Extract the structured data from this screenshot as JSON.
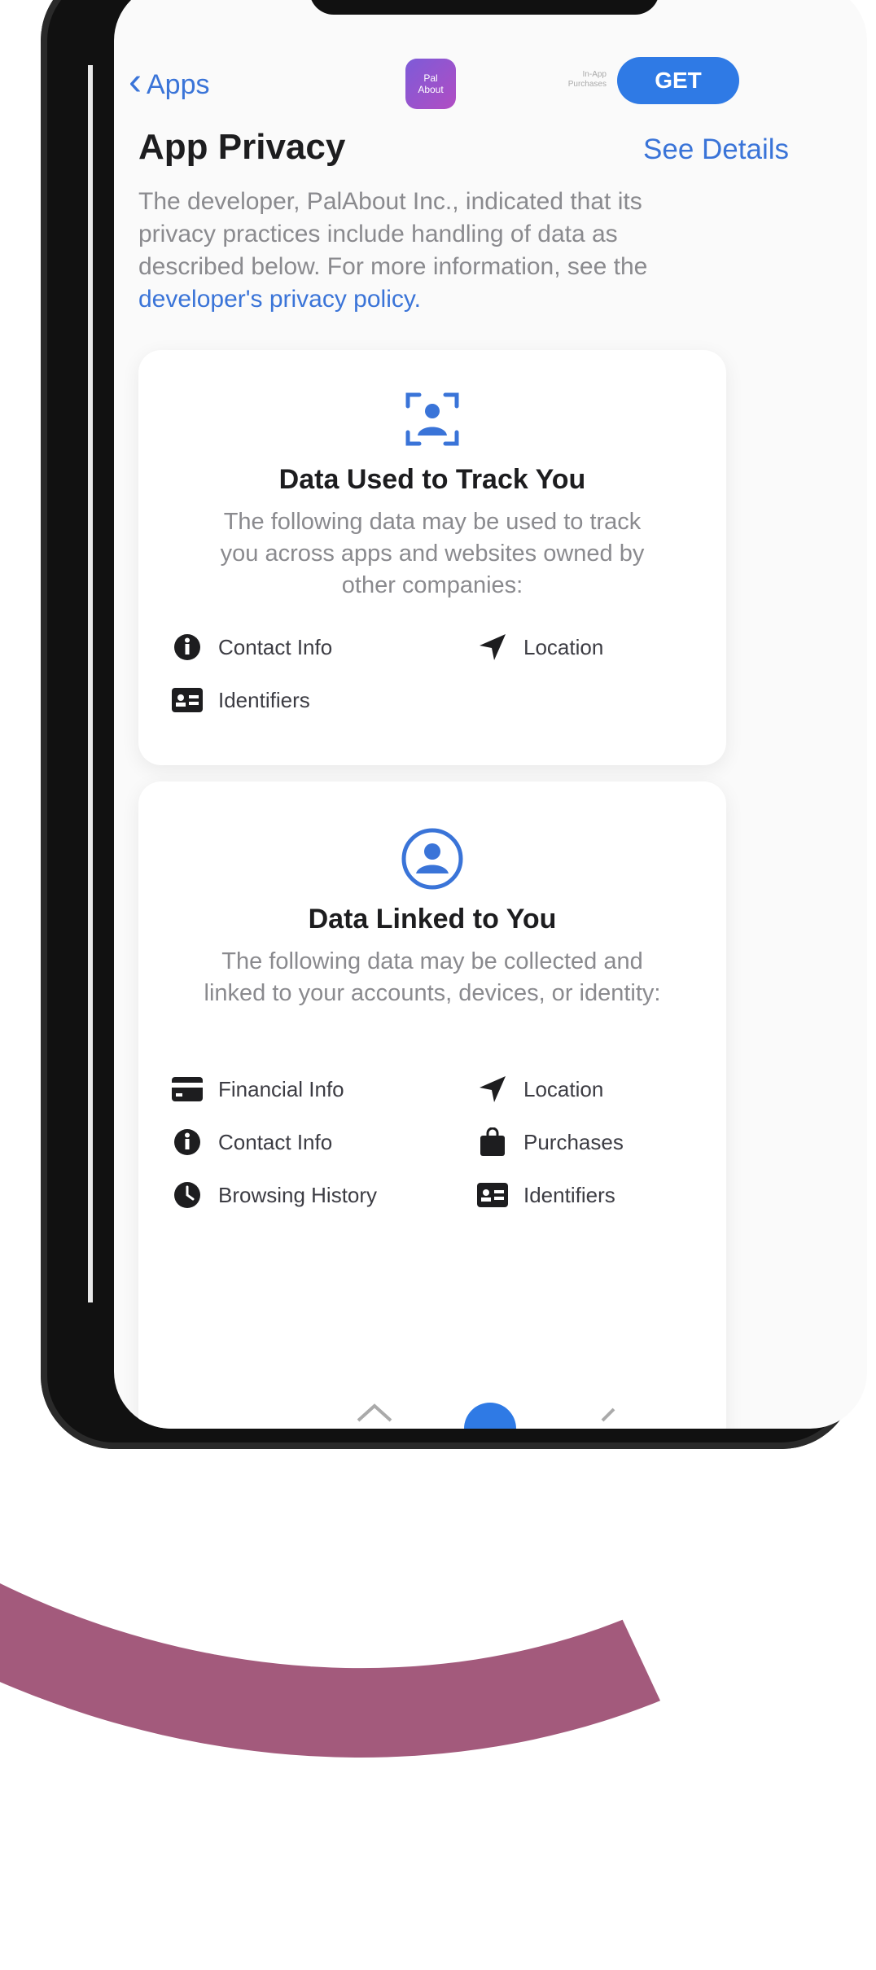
{
  "nav": {
    "back_label": "Apps",
    "app_icon_text": "Pal\nAbout",
    "meta_line1": "In-App",
    "meta_line2": "Purchases",
    "get_label": "GET"
  },
  "header": {
    "title": "App Privacy",
    "see_details": "See Details",
    "description": "The developer, PalAbout Inc., indicated that its privacy practices include handling of data as described below. For more information, see the",
    "policy_link": "developer's privacy policy."
  },
  "cards": [
    {
      "icon": "person-tracking-icon",
      "title": "Data Used to Track You",
      "description": "The following data may be used to track you across apps and websites owned by other companies:",
      "items": [
        {
          "icon": "info-circle-icon",
          "label": "Contact Info"
        },
        {
          "icon": "location-arrow-icon",
          "label": "Location"
        },
        {
          "icon": "id-card-icon",
          "label": "Identifiers"
        }
      ]
    },
    {
      "icon": "person-circle-icon",
      "title": "Data Linked to You",
      "description": "The following data may be collected and linked to your accounts, devices, or identity:",
      "items": [
        {
          "icon": "credit-card-icon",
          "label": "Financial Info"
        },
        {
          "icon": "location-arrow-icon",
          "label": "Location"
        },
        {
          "icon": "info-circle-icon",
          "label": "Contact Info"
        },
        {
          "icon": "shopping-bag-icon",
          "label": "Purchases"
        },
        {
          "icon": "clock-icon",
          "label": "Browsing History"
        },
        {
          "icon": "id-card-icon",
          "label": "Identifiers"
        }
      ]
    }
  ],
  "colors": {
    "accent": "#3a74d8",
    "get_button": "#2f7ae5",
    "text_primary": "#1d1d1f",
    "text_secondary": "#8a8a8e"
  }
}
